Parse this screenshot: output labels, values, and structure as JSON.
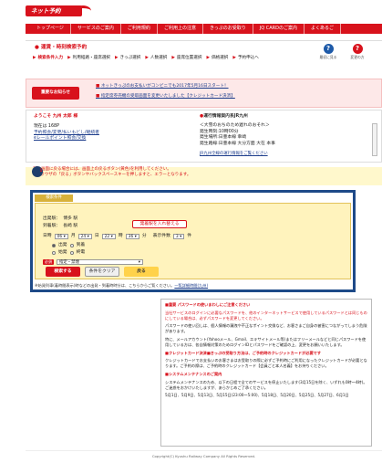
{
  "logo": {
    "text": "ネット予約"
  },
  "nav": {
    "items": [
      "トップページ",
      "サービスのご案内",
      "ご利用規約",
      "ご利用上の注意",
      "きっぷのお受取り",
      "JQ CARDのご案内",
      "よくあるご"
    ]
  },
  "steps": {
    "title": "運賃・時刻検索予約",
    "items": [
      "検索条件入力",
      "利用経路・座席選択",
      "きっぷ選択",
      "人数選択",
      "座席位置選択",
      "価格選択",
      "予約申込へ"
    ],
    "current_index": 0,
    "help": [
      {
        "icon": "?",
        "label": "最初に見る"
      },
      {
        "icon": "?",
        "label": "変更の方"
      }
    ]
  },
  "notice": {
    "label": "重要なお知らせ",
    "links": [
      "ネットきっぷのお支払いがコンビニでも2017年5月16日スタート！",
      "指定席券売機の受取画面を変更いたしました【クレジットカード決済】"
    ]
  },
  "welcome": {
    "greeting": "ようこそ 九州 太郎 様",
    "lines": [
      "現在は 168P",
      "予約照会/変更/払いもどし/継続者",
      "eレールポイント照会/交換"
    ],
    "right_title": "運行情報案内系JR九州",
    "right_lines": [
      "＜大雪のおちのため遅れのおそれ＞",
      "発生時刻:10時00分",
      "発生場所:日豊本線 幸崎",
      "発生路線:日豊本線 大分方面 大在 本事"
    ],
    "more": "JR九州全線の運行情報をご覧ください"
  },
  "warning": {
    "lines": [
      "前の画面に戻る場合には、画面上の戻るボタン(黄色)を利用してください。",
      "※ブラウザの「戻る」ボタンやバックスペースキーを押しますと、エラーとなります。"
    ]
  },
  "badge": {
    "number": "1"
  },
  "search": {
    "header": "検索条件",
    "from_label": "出発駅：",
    "from_value": "博多 駅",
    "to_label": "到着駅：",
    "to_value": "長崎 駅",
    "swap_label": "発着駅を入れ替える",
    "date_label": "日時",
    "month": "06",
    "month_unit": "月",
    "day": "24",
    "day_unit": "日",
    "hour": "22",
    "hour_unit": "時",
    "minute": "36",
    "minute_unit": "分",
    "count_label": "表示件数",
    "count": "3",
    "count_unit": "件",
    "radio_row1": [
      "出発",
      "到着"
    ],
    "radio_row2": [
      "始発",
      "終電"
    ],
    "must_label": "必須",
    "seat_value": "指定・禁煙",
    "btn_search": "検索する",
    "btn_clear": "条件をクリア",
    "btn_back": "戻る",
    "footer": "※始発列車(着時間表示)時などの出発・到着時時分は、こちらからご覧ください。",
    "footer_link": "一覧詳細時間(九州)"
  },
  "info": {
    "p1_head": "■重要 パスワードの使いまわしにご注意ください",
    "p1": "当社サービスのログインに必要なパスワードを、他のインターネットサービスで使用しているパスワードとは同じものにしている場合は、必ずパスワードを変更してください。",
    "p2": "パスワードの使い回しは、個人情報の漏洩や不正なポイント交換など、お客さまご自身の被害につながってしまう危険があります。",
    "p3": "特に、メールアカウント(Yahooメール、Gmail、エキサイトメール等)またはフリーメールなどと同じパスワードを使用している方は、各自情報対策のためログインIDとパスワードをご確認の上、変更をお願いいたします。",
    "p4_head": "■クレジットカード決済■きっぷの受取り方法は、ご予約時のクレジットカードが必要です",
    "p4": "クレジットカードでお支払いのお客さまはお受取りの際に必ずご予約時にご利用になったクレジットカードが必要となります。ご予約の際は、ご予約時のクレジットカード【会員ごと本人名義】をお持ちください。",
    "p5_head": "■システムメンテナンスのご案内",
    "p5": "システムメンテナンスのため、以下の日程で全てのサービスを停止いたします(3月15日を除く、いずれも0時～4時)。ご迷惑をおかけいたしますが、あらかじめご了承ください。",
    "p5_dates": "5月1日、5月9日、5月13日、5月15日(23:00～5:00)、5月18日、5月20日、5月25日、5月27日、6月1日"
  },
  "footer": {
    "copyright": "Copyright(C) Kyushu Railway Company All Rights Reserved."
  }
}
